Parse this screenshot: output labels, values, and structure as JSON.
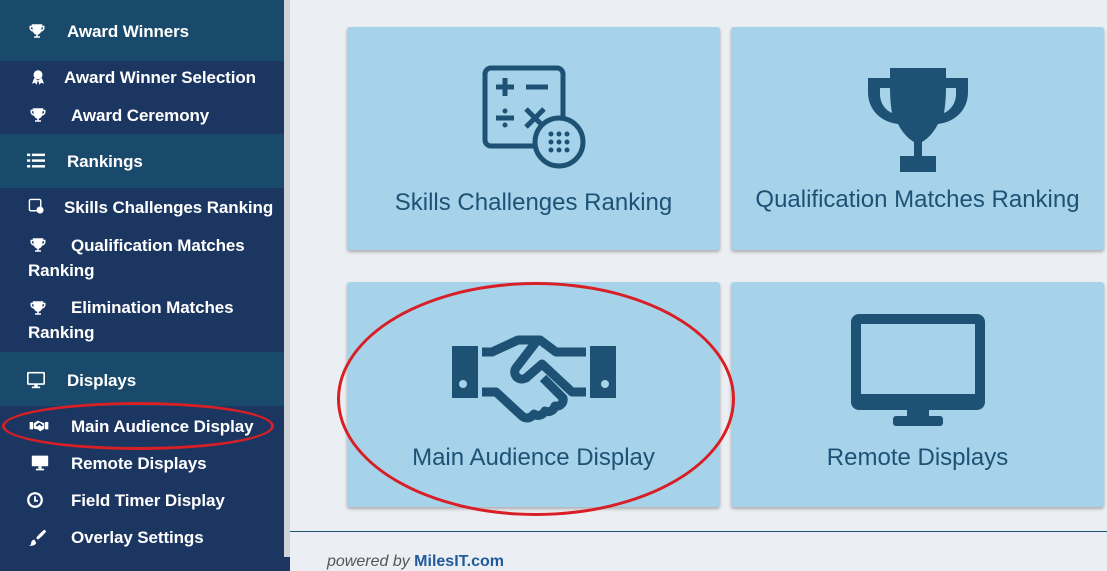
{
  "sidebar": {
    "award_winners": "Award Winners",
    "award_winner_selection": "Award Winner Selection",
    "award_ceremony": "Award Ceremony",
    "rankings": "Rankings",
    "skills_challenges_ranking": "Skills Challenges Ranking",
    "qualification_matches_ranking": "Qualification Matches Ranking",
    "elimination_matches_ranking": "Elimination Matches Ranking",
    "displays": "Displays",
    "main_audience_display": "Main Audience Display",
    "remote_displays": "Remote Displays",
    "field_timer_display": "Field Timer Display",
    "overlay_settings": "Overlay Settings"
  },
  "tiles": {
    "skills": "Skills Challenges Ranking",
    "qualification": "Qualification Matches Ranking",
    "main_audience": "Main Audience Display",
    "remote": "Remote Displays"
  },
  "footer": {
    "prefix": "powered by",
    "brand": "MilesIT.com"
  },
  "colors": {
    "sidebar_bg": "#1b3660",
    "sidebar_header_bg": "#1a4a6b",
    "tile_bg": "#a6d3ea",
    "tile_fg": "#1d5275",
    "annotation": "#d81f26"
  }
}
